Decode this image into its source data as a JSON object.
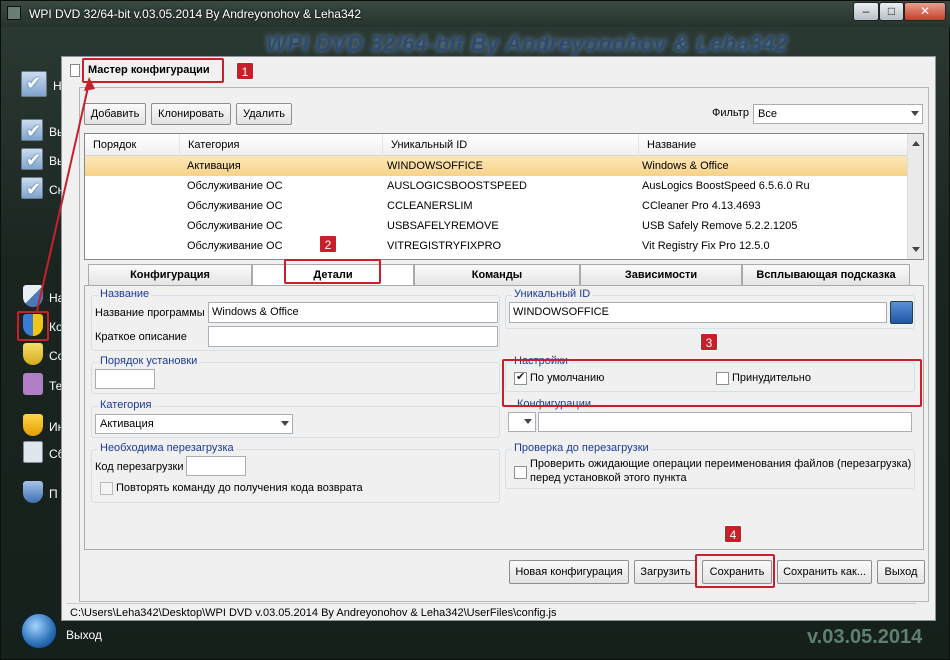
{
  "window": {
    "title": "WPI DVD 32/64-bit v.03.05.2014 By Andreyonohov & Leha342",
    "header_banner": "WPI DVD 32/64-bit By Andreyonohov & Leha342",
    "buttons": {
      "minimize": "–",
      "maximize": "□",
      "close": "✕"
    }
  },
  "sidebar": {
    "items": [
      {
        "label": "Н",
        "icon": "check-icon"
      },
      {
        "label": "Вь",
        "icon": "check-icon"
      },
      {
        "label": "Вь",
        "icon": "check-icon"
      },
      {
        "label": "Сн",
        "icon": "check-icon"
      },
      {
        "label": "На",
        "icon": "shield-icon"
      },
      {
        "label": "Ко",
        "icon": "shield-icon"
      },
      {
        "label": "Со",
        "icon": "shield-icon"
      },
      {
        "label": "Те",
        "icon": "tools-icon"
      },
      {
        "label": "Ин",
        "icon": "shield-icon"
      },
      {
        "label": "Сб",
        "icon": "document-icon"
      },
      {
        "label": "П",
        "icon": "question-icon"
      }
    ],
    "exit_label": "Выход"
  },
  "wizard": {
    "title": "Мастер конфигурации",
    "toolbar": {
      "add": "Добавить",
      "clone": "Клонировать",
      "delete": "Удалить"
    },
    "filter": {
      "label": "Фильтр",
      "value": "Все"
    },
    "grid": {
      "columns": [
        "Порядок",
        "Категория",
        "Уникальный ID",
        "Название"
      ],
      "rows": [
        {
          "order": "",
          "category": "Активация",
          "id": "WINDOWSOFFICE",
          "name": "Windows & Office"
        },
        {
          "order": "",
          "category": "Обслуживание ОС",
          "id": "AUSLOGICSBOOSTSPEED",
          "name": "AusLogics BoostSpeed 6.5.6.0 Ru"
        },
        {
          "order": "",
          "category": "Обслуживание ОС",
          "id": "CCLEANERSLIM",
          "name": "CCleaner Pro 4.13.4693"
        },
        {
          "order": "",
          "category": "Обслуживание ОС",
          "id": "USBSAFELYREMOVE",
          "name": "USB Safely Remove 5.2.2.1205"
        },
        {
          "order": "",
          "category": "Обслуживание ОС",
          "id": "VITREGISTRYFIXPRO",
          "name": "Vit Registry Fix Pro 12.5.0"
        }
      ]
    },
    "tabs": [
      "Конфигурация",
      "Детали",
      "Команды",
      "Зависимости",
      "Всплывающая подсказка"
    ],
    "details": {
      "name_group": "Название",
      "program_name_label": "Название программы",
      "program_name_value": "Windows & Office",
      "short_desc_label": "Краткое описание",
      "short_desc_value": "",
      "install_order_group": "Порядок установки",
      "install_order_value": "",
      "category_group": "Категория",
      "category_value": "Активация",
      "reboot_group": "Необходима перезагрузка",
      "reboot_code_label": "Код перезагрузки",
      "reboot_code_value": "",
      "repeat_label": "Повторять команду до получения кода возврата",
      "uid_group": "Уникальный ID",
      "uid_value": "WINDOWSOFFICE",
      "settings_group": "Настройки",
      "default_label": "По умолчанию",
      "default_checked": true,
      "forced_label": "Принудительно",
      "forced_checked": false,
      "configs_group": "Конфигурации",
      "configs_value": "",
      "pre_reboot_group": "Проверка до перезагрузки",
      "pre_reboot_label": "Проверить ожидающие операции переименования файлов (перезагрузка) перед установкой этого пункта"
    },
    "actions": {
      "new_config": "Новая конфигурация",
      "load": "Загрузить",
      "save": "Сохранить",
      "save_as": "Сохранить как...",
      "exit": "Выход"
    },
    "status_path": "C:\\Users\\Leha342\\Desktop\\WPI DVD v.03.05.2014 By Andreyonohov & Leha342\\UserFiles\\config.js"
  },
  "annotations": [
    "1",
    "2",
    "3",
    "4"
  ],
  "version_label": "v.03.05.2014",
  "colors": {
    "accent_red": "#c8202a",
    "selection": "#f7d389",
    "group_label": "#1a3a9a"
  }
}
